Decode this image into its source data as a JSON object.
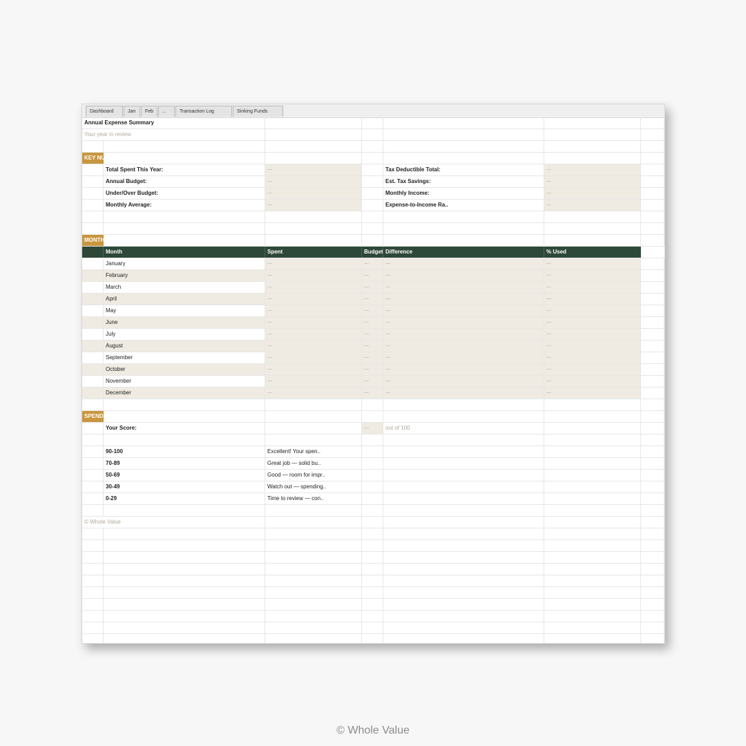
{
  "tabs": [
    "Dashboard",
    "Jan",
    "Feb",
    "...",
    "Transaction Log",
    "Sinking Funds"
  ],
  "sheet": {
    "title": "Annual Expense Summary",
    "subtitle": "Your year in review",
    "placeholder": "—",
    "key_section_label": "KEY NUMBERS",
    "key_numbers_left": [
      "Total Spent This Year:",
      "Annual Budget:",
      "Under/Over Budget:",
      "Monthly Average:"
    ],
    "key_numbers_right": [
      "Tax Deductible Total:",
      "Est. Tax Savings:",
      "Monthly Income:",
      "Expense-to-Income Ra.."
    ],
    "monthly_section_label": "MONTHLY",
    "monthly_headers": [
      "Month",
      "Spent",
      "Budget",
      "Difference",
      "% Used"
    ],
    "months": [
      "January",
      "February",
      "March",
      "April",
      "May",
      "June",
      "July",
      "August",
      "September",
      "October",
      "November",
      "December"
    ],
    "score_section_label": "SPENDING",
    "score_label": "Your Score:",
    "score_out_of": "out of 100",
    "score_ranges": [
      {
        "range": "90-100",
        "text": "Excellent! Your spen.."
      },
      {
        "range": "70-89",
        "text": "Great job — solid bu.."
      },
      {
        "range": "50-69",
        "text": "Good — room for impr.."
      },
      {
        "range": "30-49",
        "text": "Watch out — spending.."
      },
      {
        "range": "0-29",
        "text": "Time to review — con.."
      }
    ],
    "copyright": "© Whole Value"
  },
  "footer": "© Whole Value",
  "colors": {
    "accent_gold": "#c8963e",
    "header_green": "#2d4738",
    "beige_fill": "#efebe2"
  }
}
